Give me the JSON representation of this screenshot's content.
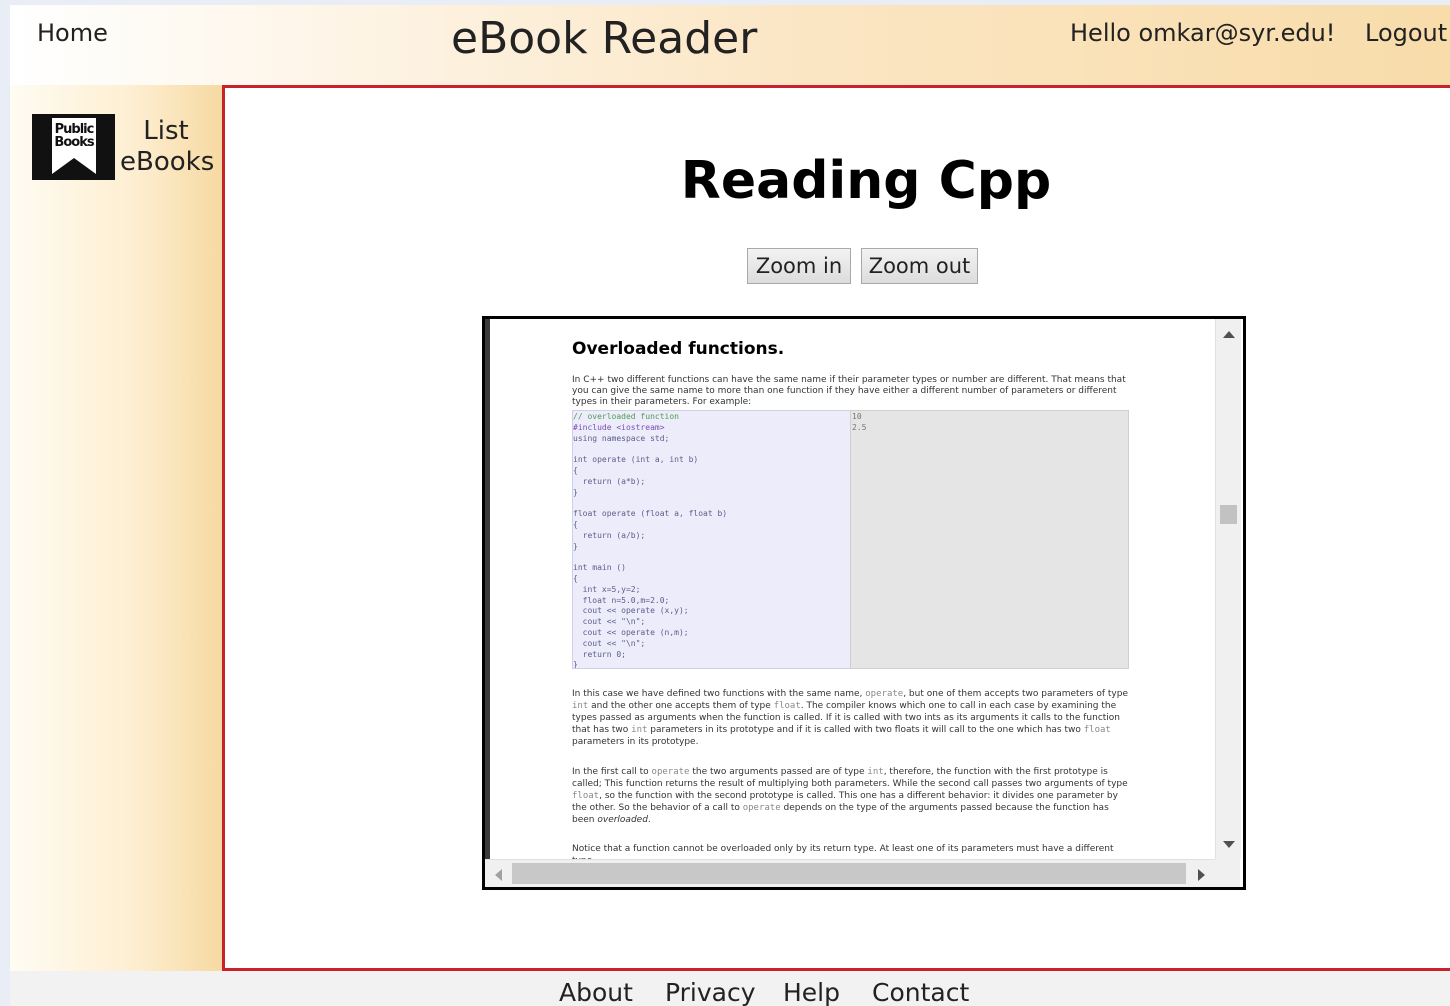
{
  "header": {
    "home_label": "Home",
    "app_title": "eBook Reader",
    "greeting": "Hello omkar@syr.edu!",
    "logout_label": "Logout"
  },
  "sidebar": {
    "logo_text": "Public Books",
    "logo_icon": "public-books-logo-icon",
    "list_label": "List eBooks"
  },
  "main": {
    "title": "Reading Cpp",
    "zoom_in_label": "Zoom in",
    "zoom_out_label": "Zoom out"
  },
  "document": {
    "heading": "Overloaded functions.",
    "intro": "In C++ two different functions can have the same name if their parameter types or number are different. That means that you can give the same name to more than one function if they have either a different number of parameters or different types in their parameters. For example:",
    "code_lines": [
      "// overloaded function",
      "#include <iostream>",
      "using namespace std;",
      "",
      "int operate (int a, int b)",
      "{",
      "  return (a*b);",
      "}",
      "",
      "float operate (float a, float b)",
      "{",
      "  return (a/b);",
      "}",
      "",
      "int main ()",
      "{",
      "  int x=5,y=2;",
      "  float n=5.0,m=2.0;",
      "  cout << operate (x,y);",
      "  cout << \"\\n\";",
      "  cout << operate (n,m);",
      "  cout << \"\\n\";",
      "  return 0;",
      "}"
    ],
    "output_lines": [
      "10",
      "2.5"
    ],
    "p2_a": "In this case we have defined two functions with the same name, ",
    "p2_code1": "operate",
    "p2_b": ", but one of them accepts two parameters of type ",
    "p2_code2": "int",
    "p2_c": " and the other one accepts them of type ",
    "p2_code3": "float",
    "p2_d": ". The compiler knows which one to call in each case by examining the types passed as arguments when the function is called. If it is called with two ints as its arguments it calls to the function that has two ",
    "p2_code4": "int",
    "p2_e": " parameters in its prototype and if it is called with two floats it will call to the one which has two ",
    "p2_code5": "float",
    "p2_f": " parameters in its prototype.",
    "p3_a": "In the first call to ",
    "p3_code1": "operate",
    "p3_b": " the two arguments passed are of type ",
    "p3_code2": "int",
    "p3_c": ", therefore, the function with the first prototype is called; This function returns the result of multiplying both parameters. While the second call passes two arguments of type ",
    "p3_code3": "float",
    "p3_d": ", so the function with the second prototype is called. This one has a different behavior: it divides one parameter by the other. So the behavior of a call to ",
    "p3_code4": "operate",
    "p3_e": " depends on the type of the arguments passed because the function has been ",
    "p3_em": "overloaded",
    "p3_f": ".",
    "p4": "Notice that a function cannot be overloaded only by its return type. At least one of its parameters must have a different type."
  },
  "footer": {
    "links": [
      "About",
      "Privacy",
      "Help",
      "Contact"
    ]
  },
  "colors": {
    "main_border": "#c8232c",
    "header_gradient_end": "#f8dcaa",
    "sidebar_gradient_end": "#f7d9a2"
  }
}
